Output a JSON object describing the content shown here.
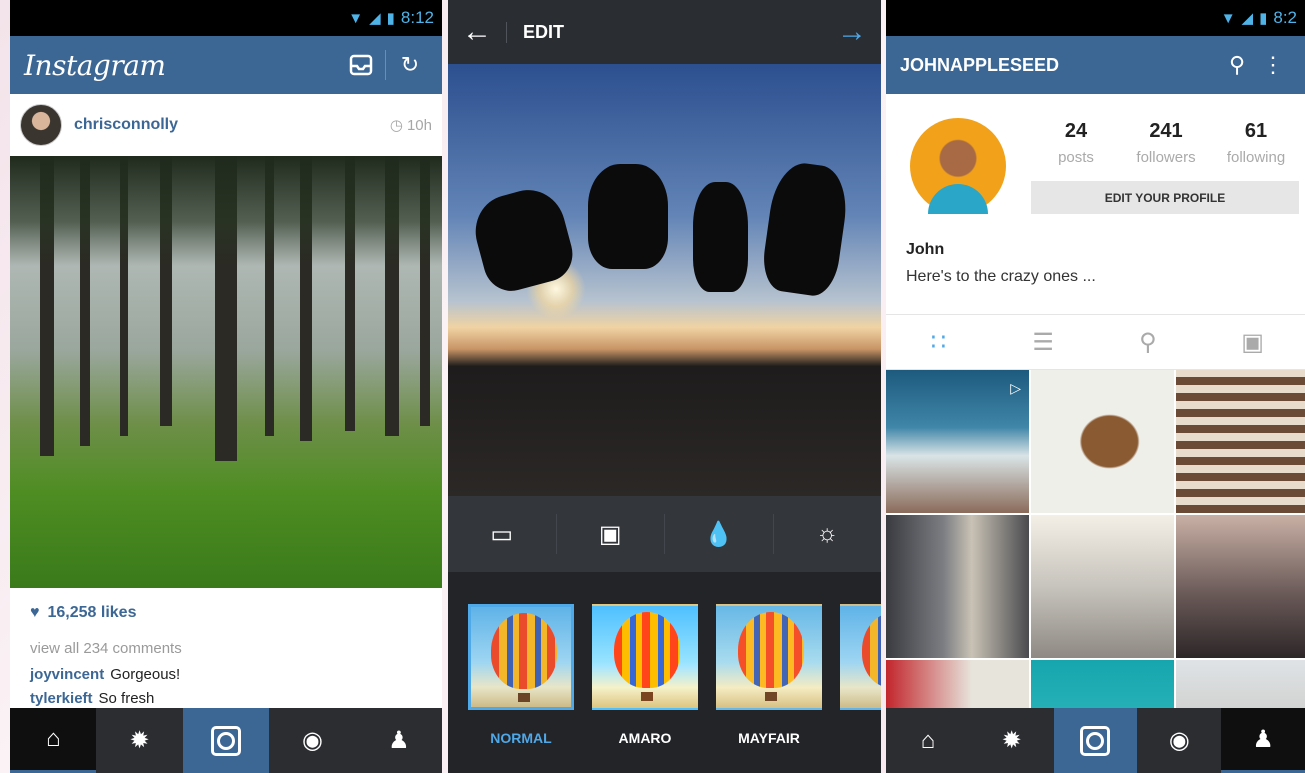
{
  "status": {
    "time": "8:12",
    "time_cut": "8:2"
  },
  "feed": {
    "app_logo": "Instagram",
    "post": {
      "username": "chrisconnolly",
      "time": "10h",
      "likes": "16,258 likes",
      "view_comments": "view all 234 comments",
      "comments": [
        {
          "user": "joyvincent",
          "text": "Gorgeous!"
        },
        {
          "user": "tylerkieft",
          "text": "So fresh"
        }
      ]
    }
  },
  "editor": {
    "title": "EDIT",
    "filters": [
      {
        "label": "NORMAL",
        "selected": true
      },
      {
        "label": "AMARO",
        "selected": false
      },
      {
        "label": "MAYFAIR",
        "selected": false
      }
    ]
  },
  "profile": {
    "username": "JOHNAPPLESEED",
    "stats": [
      {
        "num": "24",
        "label": "posts"
      },
      {
        "num": "241",
        "label": "followers"
      },
      {
        "num": "61",
        "label": "following"
      }
    ],
    "edit_button": "EDIT YOUR PROFILE",
    "name": "John",
    "bio": "Here's to the crazy ones ..."
  },
  "colors": {
    "brand_blue": "#3c6795",
    "accent_blue": "#4fa8e8",
    "dark_bar": "#2b2d31"
  }
}
